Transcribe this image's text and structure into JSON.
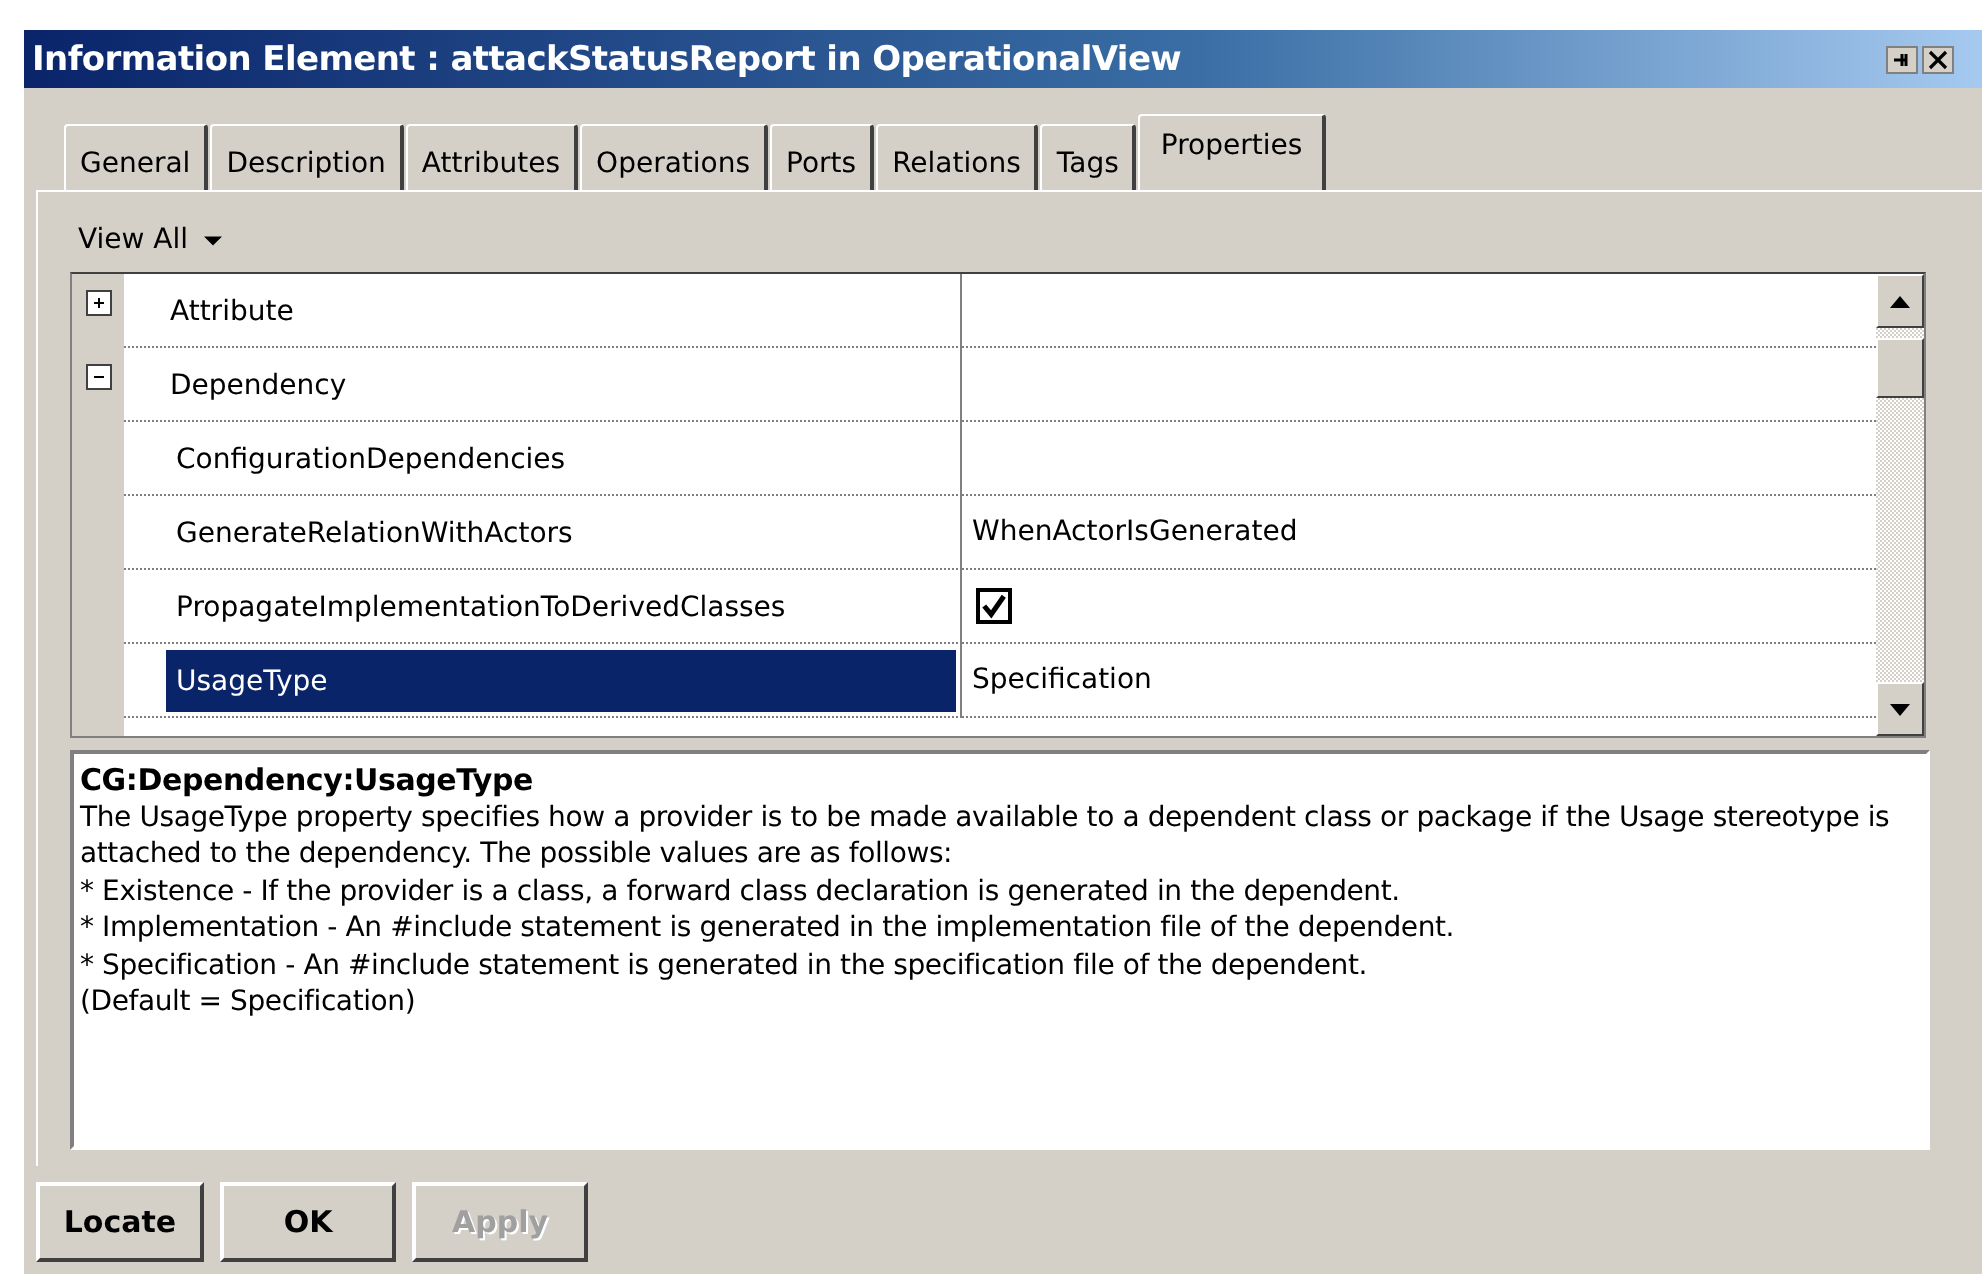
{
  "window": {
    "title": "Information Element : attackStatusReport in OperationalView"
  },
  "tabs": [
    {
      "label": "General",
      "selected": false
    },
    {
      "label": "Description",
      "selected": false
    },
    {
      "label": "Attributes",
      "selected": false
    },
    {
      "label": "Operations",
      "selected": false
    },
    {
      "label": "Ports",
      "selected": false
    },
    {
      "label": "Relations",
      "selected": false
    },
    {
      "label": "Tags",
      "selected": false
    },
    {
      "label": "Properties",
      "selected": true
    }
  ],
  "view_filter": {
    "label": "View All"
  },
  "properties": [
    {
      "kind": "group",
      "name": "Attribute",
      "expanded": false,
      "selected": false
    },
    {
      "kind": "group",
      "name": "Dependency",
      "expanded": true,
      "selected": false
    },
    {
      "kind": "text",
      "name": "ConfigurationDependencies",
      "selected": false
    },
    {
      "kind": "text",
      "name": "GenerateRelationWithActors",
      "value": "WhenActorIsGenerated",
      "selected": false
    },
    {
      "kind": "checkbox",
      "name": "PropagateImplementationToDerivedClasses",
      "checked": true,
      "selected": false
    },
    {
      "kind": "text",
      "name": "UsageType",
      "value": "Specification",
      "selected": true
    }
  ],
  "description": {
    "heading": "CG:Dependency:UsageType",
    "lines": [
      "The UsageType property specifies how a provider is to be made available to a dependent class or package if the Usage stereotype is attached to the dependency. The possible values are as follows:",
      "*  Existence - If the provider is a class, a forward class declaration is generated in the dependent.",
      "*  Implementation - An #include statement is generated in the implementation file of the dependent.",
      "*  Specification - An #include statement is generated in the specification file of the dependent.",
      "(Default = Specification)"
    ]
  },
  "buttons": [
    {
      "label": "Locate",
      "disabled": false
    },
    {
      "label": "OK",
      "disabled": false
    },
    {
      "label": "Apply",
      "disabled": true
    }
  ]
}
